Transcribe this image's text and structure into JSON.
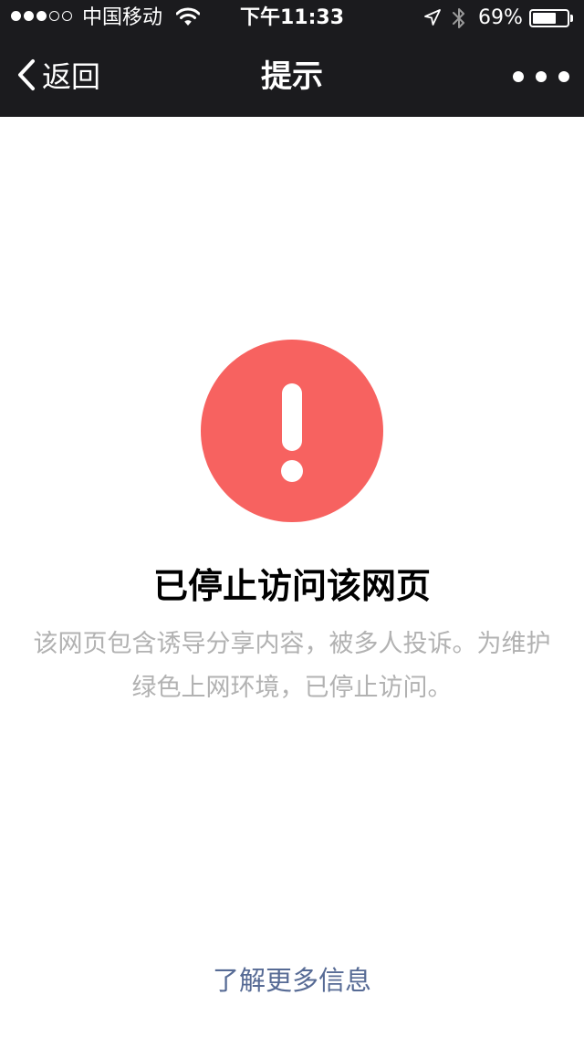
{
  "status_bar": {
    "signal_dots_filled": 3,
    "signal_dots_total": 5,
    "carrier": "中国移动",
    "time": "下午11:33",
    "battery_percent": "69%",
    "battery_level": 0.69
  },
  "nav": {
    "back_label": "返回",
    "title": "提示",
    "more_icon": "more-dots-icon"
  },
  "alert": {
    "icon": "exclamation-circle-icon",
    "color": "#f76260"
  },
  "message": {
    "headline": "已停止访问该网页",
    "description_line1": "该网页包含诱导分享内容，被多人投诉。为维护",
    "description_line2": "绿色上网环境，已停止访问。"
  },
  "footer": {
    "more_info_link": "了解更多信息",
    "link_color": "#576b95"
  }
}
